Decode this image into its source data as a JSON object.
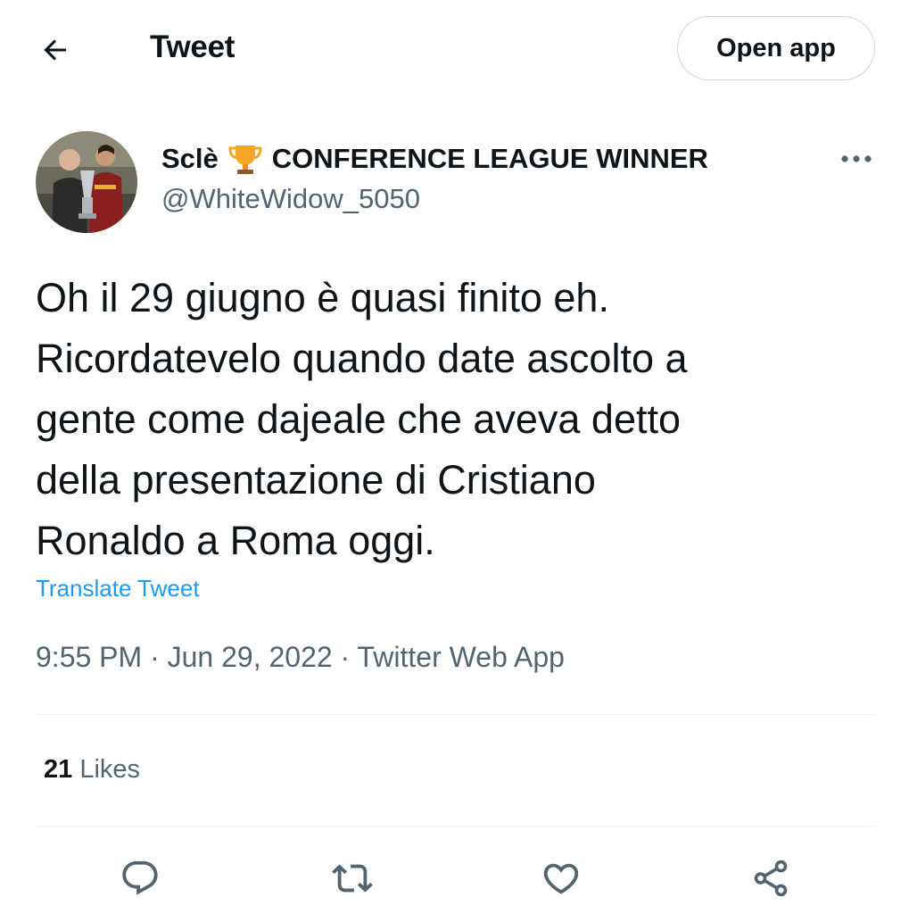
{
  "header": {
    "title": "Tweet",
    "open_app_label": "Open app",
    "back_icon": "arrow-left-icon"
  },
  "author": {
    "display_name": "Sclè",
    "badge_emoji": "🏆",
    "display_name_suffix": "CONFERENCE LEAGUE WINNER",
    "handle": "@WhiteWidow_5050",
    "more_icon": "more-horizontal-icon"
  },
  "tweet": {
    "text": "Oh il 29 giugno è quasi finito eh.\nRicordatevelo quando date ascolto a\ngente come dajeale che aveva detto\ndella presentazione di Cristiano\nRonaldo a Roma oggi.",
    "translate_label": "Translate Tweet",
    "time": "9:55 PM",
    "date": "Jun 29, 2022",
    "source": "Twitter Web App",
    "separator": " · "
  },
  "stats": {
    "likes_count": "21",
    "likes_label": "Likes"
  },
  "actions": [
    {
      "name": "reply-icon"
    },
    {
      "name": "retweet-icon"
    },
    {
      "name": "like-icon"
    },
    {
      "name": "share-icon"
    }
  ],
  "colors": {
    "text_primary": "#0f1419",
    "text_secondary": "#536471",
    "accent": "#1d9bf0",
    "divider": "#eff3f4",
    "border": "#cfd9de"
  }
}
